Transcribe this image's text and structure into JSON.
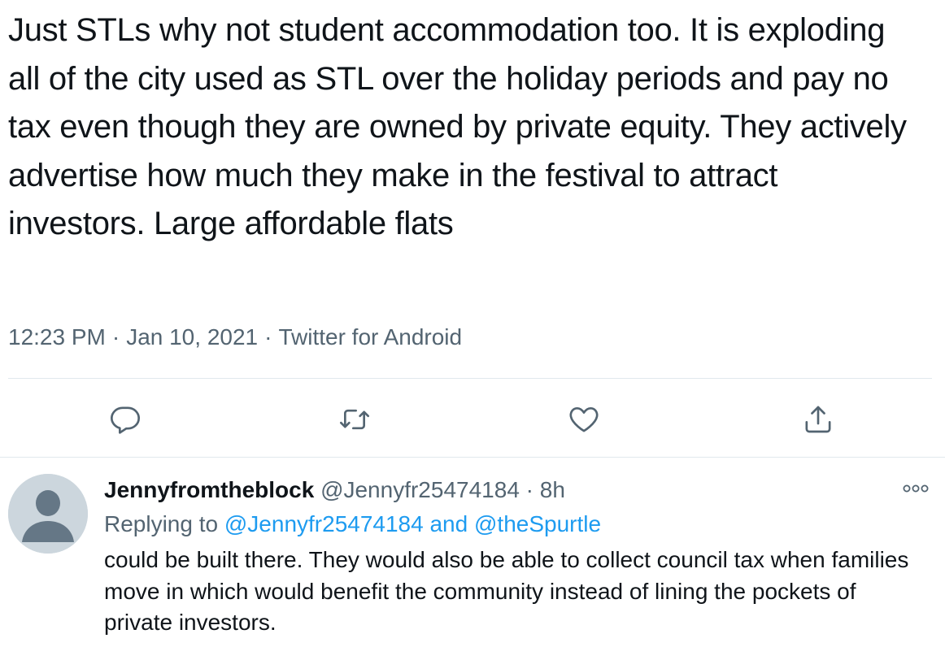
{
  "main_tweet": {
    "text": "Just STLs why not student accommodation too. It is exploding all of the city used as STL over the holiday periods and pay no tax even though they are owned by private equity. They actively advertise how much they make in the festival to attract investors. Large affordable flats",
    "time": "12:23 PM",
    "date": "Jan 10, 2021",
    "source": "Twitter for Android",
    "separator": "·"
  },
  "actions": {
    "reply_icon": "reply-icon",
    "retweet_icon": "retweet-icon",
    "like_icon": "heart-icon",
    "share_icon": "share-icon"
  },
  "reply": {
    "display_name": "Jennyfromtheblock",
    "handle": "@Jennyfr25474184",
    "separator": "·",
    "time": "8h",
    "replying_prefix": "Replying to",
    "replying_user_1": "@Jennyfr25474184",
    "replying_and": "and",
    "replying_user_2": "@theSpurtle",
    "text": "could be built there. They would also be able to collect council tax when families move in which would benefit the community instead of lining the pockets of private investors.",
    "more_icon": "more-icon"
  },
  "colors": {
    "text": "#0f1419",
    "secondary": "#536471",
    "link": "#1d9bf0",
    "divider": "#e1e8ed",
    "icon": "#536471"
  }
}
